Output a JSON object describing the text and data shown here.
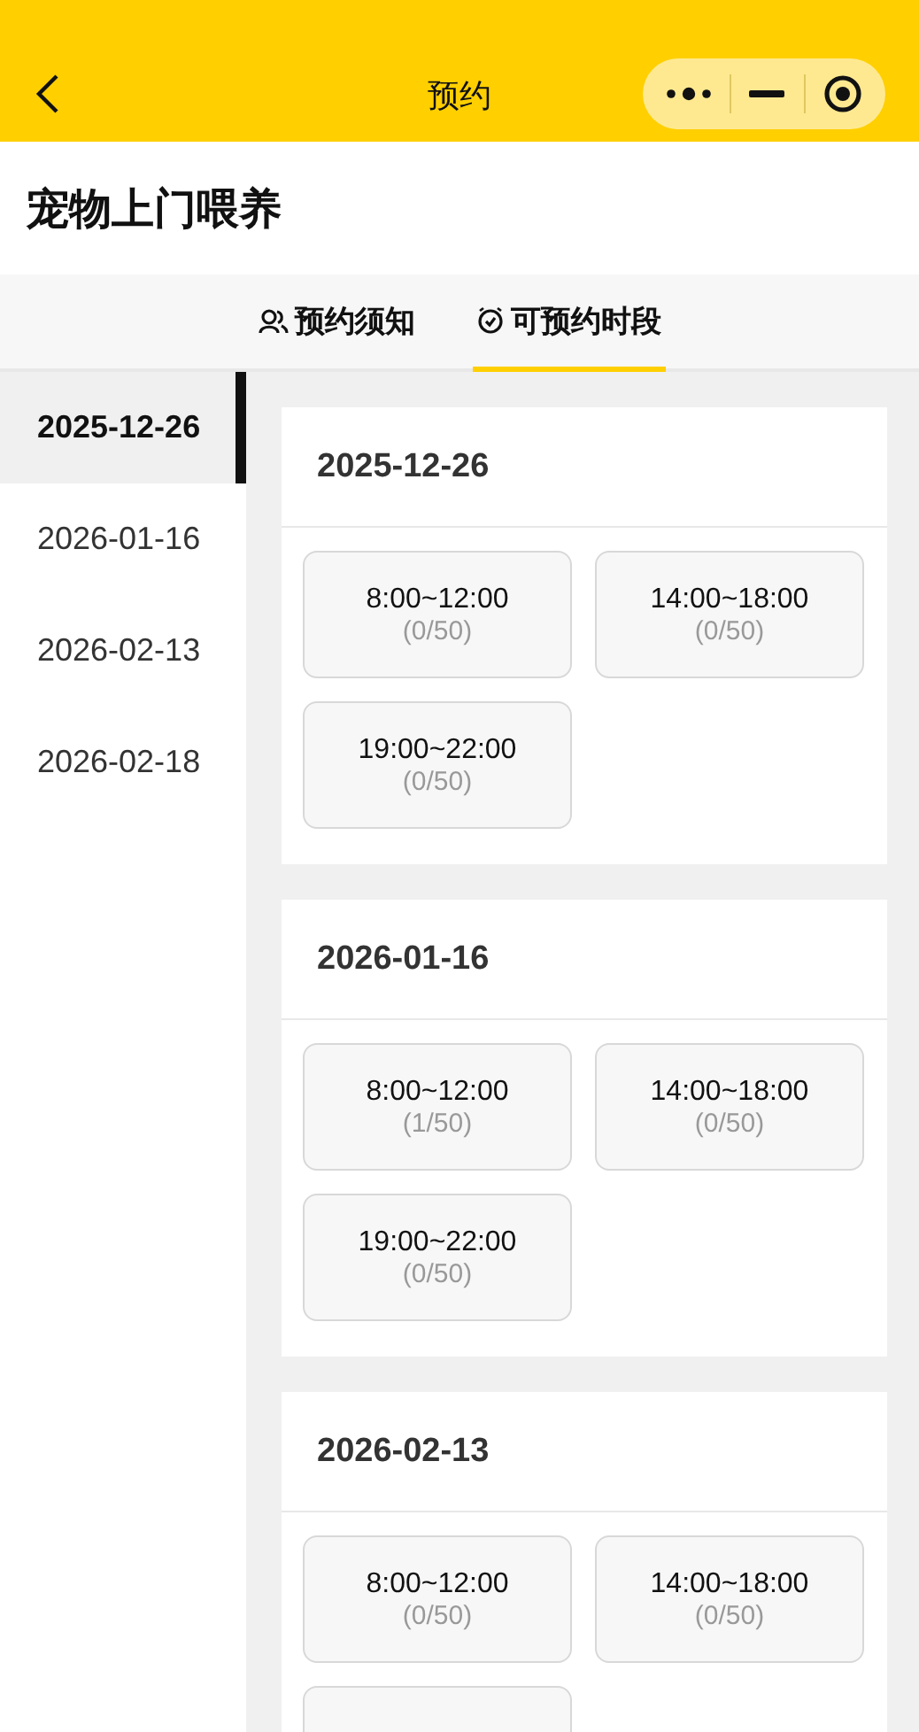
{
  "nav_bar": {
    "title": "预约"
  },
  "page_title": "宠物上门喂养",
  "tabs": [
    {
      "label": "预约须知",
      "kind": "notice",
      "selected": false
    },
    {
      "label": "可预约时段",
      "kind": "schedule",
      "selected": true
    }
  ],
  "dates": [
    {
      "label": "2025-12-26",
      "selected": true
    },
    {
      "label": "2026-01-16",
      "selected": false
    },
    {
      "label": "2026-02-13",
      "selected": false
    },
    {
      "label": "2026-02-18",
      "selected": false
    }
  ],
  "days": [
    {
      "date": "2025-12-26",
      "slots": [
        {
          "kind": "slot",
          "time": "8:00~12:00",
          "count": "(0/50)"
        },
        {
          "kind": "slot",
          "time": "14:00~18:00",
          "count": "(0/50)"
        },
        {
          "kind": "slot",
          "time": "19:00~22:00",
          "count": "(0/50)"
        }
      ]
    },
    {
      "date": "2026-01-16",
      "slots": [
        {
          "kind": "slot",
          "time": "8:00~12:00",
          "count": "(1/50)"
        },
        {
          "kind": "slot",
          "time": "14:00~18:00",
          "count": "(0/50)"
        },
        {
          "kind": "slot",
          "time": "19:00~22:00",
          "count": "(0/50)"
        }
      ]
    },
    {
      "date": "2026-02-13",
      "slots": [
        {
          "kind": "slot",
          "time": "8:00~12:00",
          "count": "(0/50)"
        },
        {
          "kind": "slot",
          "time": "14:00~18:00",
          "count": "(0/50)"
        },
        {
          "kind": "cut"
        }
      ]
    }
  ]
}
